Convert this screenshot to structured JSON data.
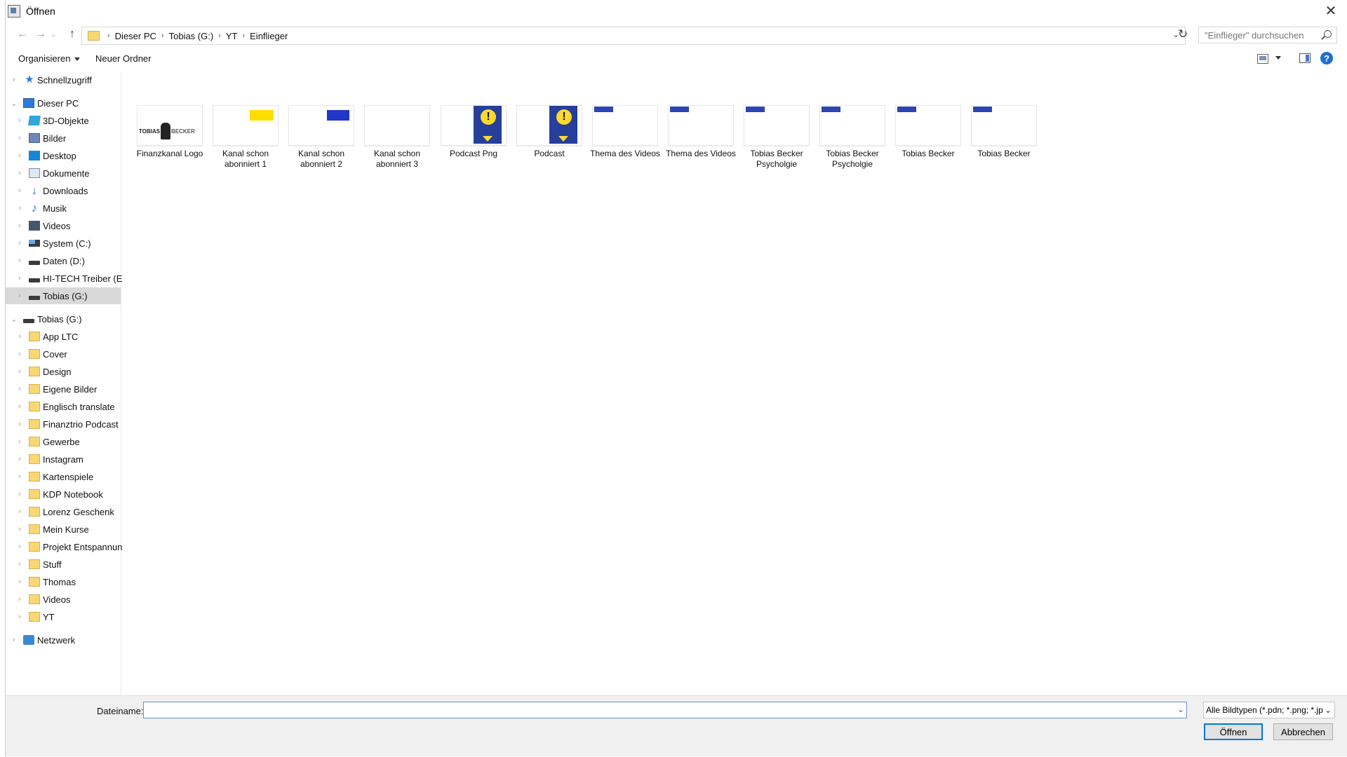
{
  "window": {
    "title": "Öffnen"
  },
  "address": {
    "breadcrumbs": [
      "Dieser PC",
      "Tobias (G:)",
      "YT",
      "Einflieger"
    ],
    "search_placeholder": "\"Einflieger\" durchsuchen"
  },
  "toolbar": {
    "organize_label": "Organisieren",
    "new_folder_label": "Neuer Ordner"
  },
  "sidebar": {
    "items": [
      {
        "label": "Schnellzugriff",
        "icon": "star-icon"
      },
      {
        "label": "Dieser PC",
        "icon": "computer-icon"
      },
      {
        "label": "3D-Objekte",
        "icon": "cube-icon"
      },
      {
        "label": "Bilder",
        "icon": "pictures-icon"
      },
      {
        "label": "Desktop",
        "icon": "desktop-icon"
      },
      {
        "label": "Dokumente",
        "icon": "documents-icon"
      },
      {
        "label": "Downloads",
        "icon": "downloads-icon"
      },
      {
        "label": "Musik",
        "icon": "music-icon"
      },
      {
        "label": "Videos",
        "icon": "videos-icon"
      },
      {
        "label": "System (C:)",
        "icon": "system-drive-icon"
      },
      {
        "label": "Daten (D:)",
        "icon": "drive-icon"
      },
      {
        "label": "HI-TECH Treiber (E:)",
        "icon": "drive-icon"
      },
      {
        "label": "Tobias (G:)",
        "icon": "drive-icon",
        "selected": true
      },
      {
        "label": "Tobias (G:)",
        "icon": "drive-icon"
      },
      {
        "label": "App LTC",
        "icon": "folder-icon"
      },
      {
        "label": "Cover",
        "icon": "folder-icon"
      },
      {
        "label": "Design",
        "icon": "folder-icon"
      },
      {
        "label": "Eigene Bilder",
        "icon": "folder-icon"
      },
      {
        "label": "Englisch translate",
        "icon": "folder-icon"
      },
      {
        "label": "Finanztrio Podcast",
        "icon": "folder-icon"
      },
      {
        "label": "Gewerbe",
        "icon": "folder-icon"
      },
      {
        "label": "Instagram",
        "icon": "folder-icon"
      },
      {
        "label": "Kartenspiele",
        "icon": "folder-icon"
      },
      {
        "label": "KDP Notebook",
        "icon": "folder-icon"
      },
      {
        "label": "Lorenz Geschenk",
        "icon": "folder-icon"
      },
      {
        "label": "Mein Kurse",
        "icon": "folder-icon"
      },
      {
        "label": "Projekt Entspannun",
        "icon": "folder-icon"
      },
      {
        "label": "Stuff",
        "icon": "folder-icon"
      },
      {
        "label": "Thomas",
        "icon": "folder-icon"
      },
      {
        "label": "Videos",
        "icon": "folder-icon"
      },
      {
        "label": "YT",
        "icon": "folder-icon"
      },
      {
        "label": "Netzwerk",
        "icon": "network-icon"
      }
    ]
  },
  "files": [
    {
      "name": "Finanzkanal Logo",
      "thumb": "logo-thumbnail",
      "thumb_text_left": "TOBIAS",
      "thumb_text_right": "BECKER"
    },
    {
      "name": "Kanal schon abonniert 1",
      "thumb": "yellow-thumbnail"
    },
    {
      "name": "Kanal schon abonniert 2",
      "thumb": "blue-thumbnail"
    },
    {
      "name": "Kanal schon abonniert 3",
      "thumb": "blank-thumbnail"
    },
    {
      "name": "Podcast Png",
      "thumb": "podcast-thumbnail",
      "badge": "!"
    },
    {
      "name": "Podcast",
      "thumb": "podcast-thumbnail",
      "badge": "!"
    },
    {
      "name": "Thema des Videos",
      "thumb": "banner-thumbnail"
    },
    {
      "name": "Thema des Videos",
      "thumb": "banner-thumbnail"
    },
    {
      "name": "Tobias Becker Psycholgie",
      "thumb": "banner-thumbnail"
    },
    {
      "name": "Tobias Becker Psycholgie",
      "thumb": "banner-thumbnail"
    },
    {
      "name": "Tobias Becker",
      "thumb": "banner-thumbnail"
    },
    {
      "name": "Tobias Becker",
      "thumb": "banner-thumbnail"
    }
  ],
  "footer": {
    "filename_label": "Dateiname:",
    "filename_value": "",
    "filetype_value": "Alle Bildtypen (*.pdn; *.png; *.jp",
    "open_label": "Öffnen",
    "cancel_label": "Abbrechen"
  },
  "colors": {
    "accent": "#0078d7",
    "folder": "#f8d775",
    "selected_row": "#d9d9d9"
  }
}
